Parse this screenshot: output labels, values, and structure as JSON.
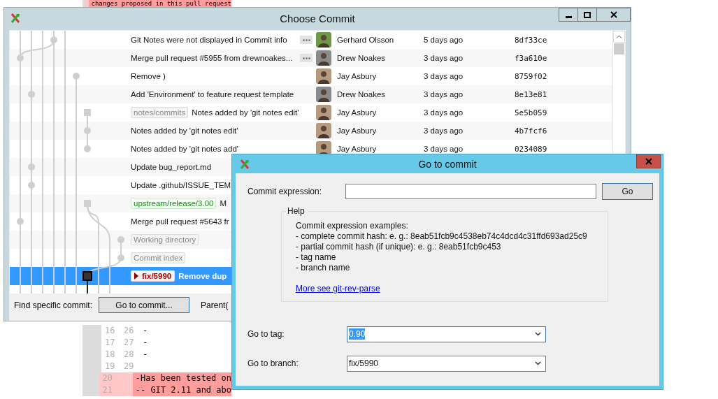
{
  "background_diff": {
    "top_line": {
      "kind": "removed",
      "text": "changes proposed in this pull request"
    },
    "lines": [
      {
        "kind": "context",
        "old": "16",
        "new": "26",
        "text": "-"
      },
      {
        "kind": "context",
        "old": "17",
        "new": "27",
        "text": "-"
      },
      {
        "kind": "context",
        "old": "18",
        "new": "28",
        "text": "-"
      },
      {
        "kind": "context",
        "old": "19",
        "new": "29"
      },
      {
        "kind": "removed",
        "old": "20",
        "text": "-Has been tested on"
      },
      {
        "kind": "removed",
        "old": "21",
        "text": "-- GIT 2.11 and abo"
      }
    ]
  },
  "choose_commit_window": {
    "title": "Choose Commit",
    "rows": [
      {
        "message": "Git Notes were not displayed in Commit info",
        "more": true,
        "author": "Gerhard Olsson",
        "avatar": {
          "color": "#6f9a45"
        },
        "date": "5 days ago",
        "hash": "8df33ce",
        "selected": false
      },
      {
        "message": "Merge pull request #5955 from drewnoakes...",
        "more": true,
        "author": "Drew Noakes",
        "avatar": {
          "color": "#8a8a8a"
        },
        "date": "3 days ago",
        "hash": "f3a610e",
        "selected": false
      },
      {
        "message": "Remove )",
        "author": "Jay Asbury",
        "avatar": {
          "color": "#b59a80"
        },
        "date": "3 days ago",
        "hash": "8759f02",
        "selected": false
      },
      {
        "message": "Add 'Environment' to feature request template",
        "author": "Drew Noakes",
        "avatar": {
          "color": "#8a8a8a"
        },
        "date": "3 days ago",
        "hash": "8e13e81",
        "selected": false
      },
      {
        "refs": [
          {
            "kind": "notes",
            "name": "notes/commits"
          }
        ],
        "message": "Notes added by 'git notes edit'",
        "author": "Jay Asbury",
        "avatar": {
          "color": "#b59a80"
        },
        "date": "3 days ago",
        "hash": "5e5b059",
        "selected": false
      },
      {
        "message": "Notes added by 'git notes edit'",
        "author": "Jay Asbury",
        "avatar": {
          "color": "#b59a80"
        },
        "date": "3 days ago",
        "hash": "4b7fcf6",
        "selected": false
      },
      {
        "message": "Notes added by 'git notes add'",
        "author": "Jay Asbury",
        "avatar": {
          "color": "#b59a80"
        },
        "date": "3 days ago",
        "hash": "0234089",
        "selected": false
      },
      {
        "message": "Update bug_report.md",
        "selected": false
      },
      {
        "message": "Update .github/ISSUE_TEM",
        "selected": false
      },
      {
        "refs": [
          {
            "kind": "remote",
            "name": "upstream/release/3.00"
          }
        ],
        "message": "M",
        "selected": false
      },
      {
        "message": "Merge pull request #5643 fr",
        "selected": false
      },
      {
        "refs": [
          {
            "kind": "worktree",
            "name": "Working directory"
          }
        ],
        "selected": false
      },
      {
        "refs": [
          {
            "kind": "worktree",
            "name": "Commit index"
          }
        ],
        "selected": false
      },
      {
        "refs": [
          {
            "kind": "current",
            "name": "fix/5990"
          }
        ],
        "message": "Remove dup",
        "selected": true
      }
    ],
    "footer": {
      "label": "Find specific commit:",
      "button": "Go to commit...",
      "parent_label": "Parent("
    }
  },
  "go_to_commit_dialog": {
    "title": "Go to commit",
    "expression": {
      "label": "Commit expression:"
    },
    "go_button": "Go",
    "help": {
      "title": "Help",
      "lines": [
        "Commit expression examples:",
        "- complete commit hash: e. g.: 8eab51fcb9c4538eb74c4dcd4c31ffd693ad25c9",
        "- partial commit hash (if unique): e. g.: 8eab51fcb9c453",
        "- tag name",
        "- branch name"
      ],
      "link": "More see git-rev-parse"
    },
    "tag": {
      "label": "Go to tag:",
      "value": "0.90",
      "text_selected": true
    },
    "branch": {
      "label": "Go to branch:",
      "value": "fix/5990",
      "text_selected": false
    }
  }
}
